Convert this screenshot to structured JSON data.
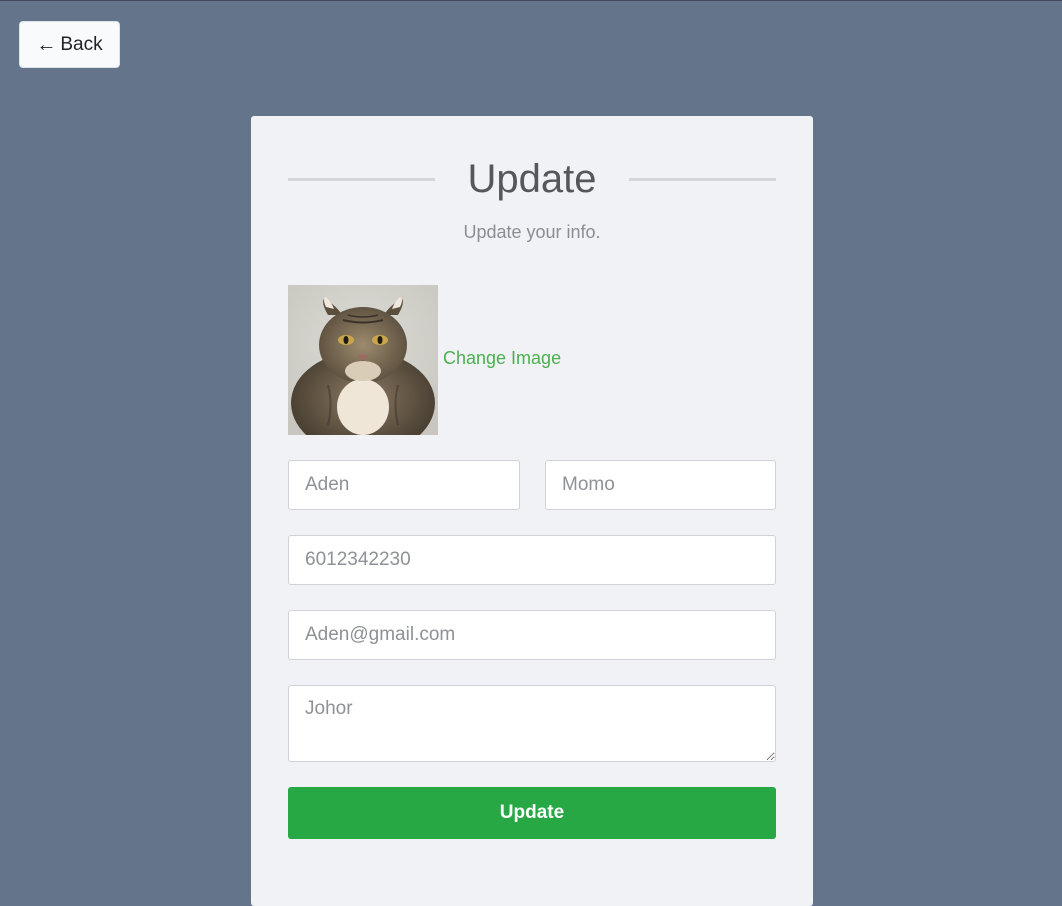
{
  "nav": {
    "back_label": "Back"
  },
  "form": {
    "title": "Update",
    "subtitle": "Update your info.",
    "change_image_label": "Change Image",
    "first_name_placeholder": "Aden",
    "last_name_placeholder": "Momo",
    "phone_placeholder": "6012342230",
    "email_placeholder": "Aden@gmail.com",
    "address_placeholder": "Johor",
    "submit_label": "Update"
  },
  "colors": {
    "background": "#64748b",
    "card": "#f1f2f5",
    "accent_green": "#28a745",
    "link_green": "#4caf50"
  },
  "icons": {
    "back": "left-arrow-icon"
  },
  "avatar": {
    "subject": "cat-photo"
  }
}
